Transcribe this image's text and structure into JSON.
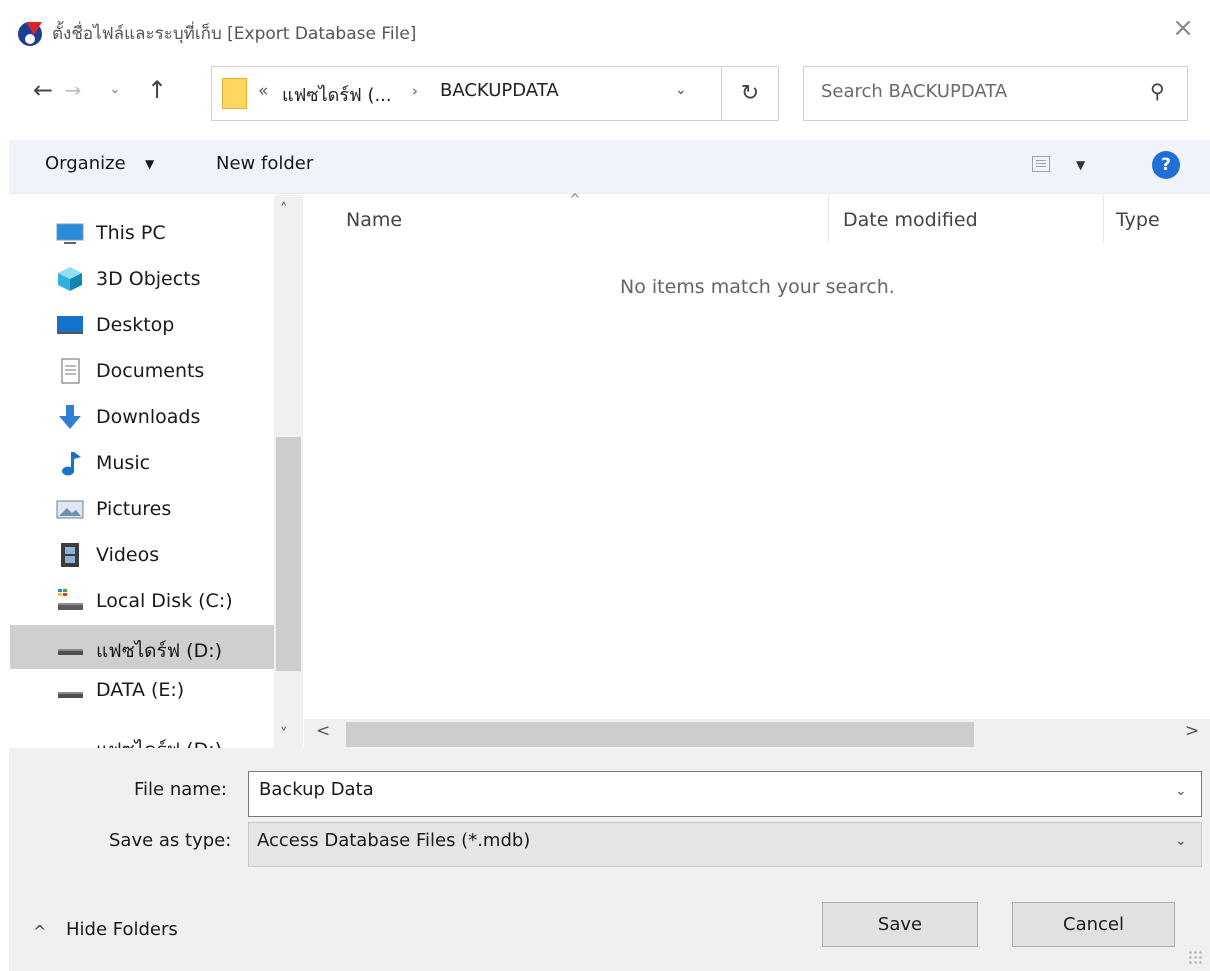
{
  "window": {
    "title": "ตั้งชื่อไฟล์และระบุที่เก็บ [Export Database File]",
    "close_label": "×"
  },
  "address_bar": {
    "back_glyph": "←",
    "forward_glyph": "→",
    "recent_glyph": "⌄",
    "up_glyph": "↑",
    "overflow_glyph": "«",
    "path": [
      "แฟซไดร์ฟ (...",
      "BACKUPDATA"
    ],
    "separator": "›",
    "dropdown_glyph": "⌄",
    "refresh_glyph": "↻"
  },
  "search": {
    "placeholder": "Search BACKUPDATA",
    "icon_glyph": "⚲"
  },
  "toolbar": {
    "organize_label": "Organize",
    "caret": "▼",
    "new_folder_label": "New folder",
    "help_label": "?"
  },
  "navigation": {
    "items": [
      {
        "label": "This PC",
        "icon": "computer-icon"
      },
      {
        "label": "3D Objects",
        "icon": "cube-icon"
      },
      {
        "label": "Desktop",
        "icon": "desktop-icon"
      },
      {
        "label": "Documents",
        "icon": "document-icon"
      },
      {
        "label": "Downloads",
        "icon": "download-arrow-icon"
      },
      {
        "label": "Music",
        "icon": "music-note-icon"
      },
      {
        "label": "Pictures",
        "icon": "picture-icon"
      },
      {
        "label": "Videos",
        "icon": "film-icon"
      },
      {
        "label": "Local Disk (C:)",
        "icon": "drive-icon"
      },
      {
        "label": "แฟซไดร์ฟ (D:)",
        "icon": "drive-icon",
        "selected": true
      },
      {
        "label": "DATA  (E:)",
        "icon": "drive-icon"
      },
      {
        "label": "แฟซไดร์ฟ (D:)",
        "icon": "drive-icon"
      }
    ],
    "scroll_up": "˄",
    "scroll_down": "˅"
  },
  "file_list": {
    "sort_indicator": "^",
    "columns": [
      "Name",
      "Date modified",
      "Type"
    ],
    "empty_message": "No items match your search.",
    "scroll_left": "<",
    "scroll_right": ">"
  },
  "form": {
    "file_name_label": "File name:",
    "file_name_value": "Backup Data",
    "save_type_label": "Save as type:",
    "save_type_value": "Access Database Files (*.mdb)",
    "dropdown_glyph": "⌄"
  },
  "footer": {
    "hide_folders_caret": "^",
    "hide_folders_label": "Hide Folders",
    "save_label": "Save",
    "cancel_label": "Cancel"
  },
  "colors": {
    "toolbar_bg": "#f0f3f9",
    "selection_bg": "#cfcfcf",
    "help_blue": "#1f6fd6",
    "folder_yellow": "#ffd65e"
  }
}
